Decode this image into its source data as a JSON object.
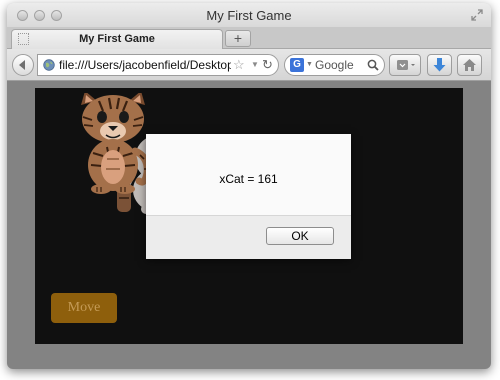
{
  "window": {
    "title": "My First Game"
  },
  "tab": {
    "label": "My First Game",
    "new_tab_label": "+"
  },
  "navbar": {
    "url": "file:///Users/jacobenfield/Desktop/index.html",
    "search_engine": "G",
    "search_placeholder": "Google"
  },
  "icons": {
    "back": "back-arrow-icon",
    "globe": "globe-icon",
    "bookmark": "star-icon",
    "reload": "reload-icon",
    "search": "magnifier-icon",
    "extensions": "puzzle-icon",
    "downloads": "download-arrow-icon",
    "home": "home-icon"
  },
  "game": {
    "move_label": "Move"
  },
  "alert": {
    "message": "xCat = 161",
    "ok_label": "OK"
  },
  "colors": {
    "canvas_bg": "#101010",
    "move_button": "#8e5f0c",
    "download_accent": "#3d86d8"
  }
}
